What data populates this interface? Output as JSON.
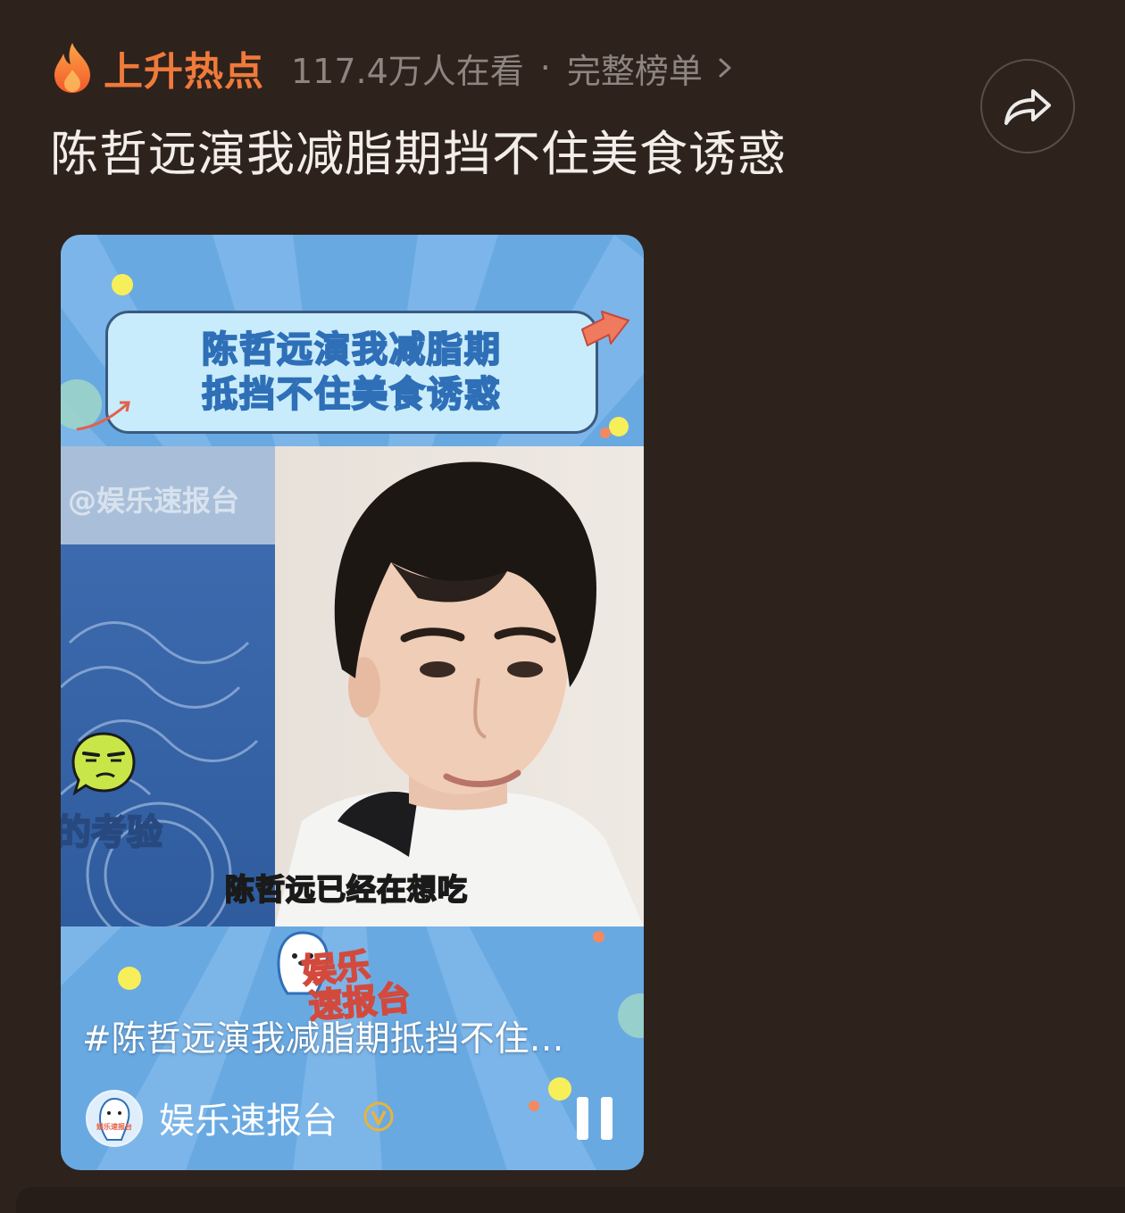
{
  "header": {
    "hot_label": "上升热点",
    "viewers": "117.4万人在看",
    "separator": "·",
    "full_list_label": "完整榜单",
    "topic_title": "陈哲远演我减脂期挡不住美食诱惑"
  },
  "video": {
    "banner_line1": "陈哲远演我减脂期",
    "banner_line2": "抵挡不住美食诱惑",
    "watermark": "@娱乐速报台",
    "side_caption": "的考验",
    "subtitle": "陈哲远已经在想吃",
    "logo_line1": "娱乐",
    "logo_line2": "速报台",
    "hashtag": "#陈哲远演我减脂期抵挡不住…",
    "author_name": "娱乐速报台",
    "avatar_text": "娱乐速报台",
    "state": "playing"
  },
  "icons": {
    "flame": "flame-icon",
    "chevron": "chevron-right-icon",
    "share": "share-icon",
    "verified": "verified-icon",
    "pause": "pause-icon"
  },
  "colors": {
    "page_background": "#2e221d",
    "hot_accent": "#f07a3a",
    "muted_text": "#8f8580",
    "title_text": "#f2ede9",
    "card_background": "#69a9e2",
    "verified": "#e8b43a"
  }
}
